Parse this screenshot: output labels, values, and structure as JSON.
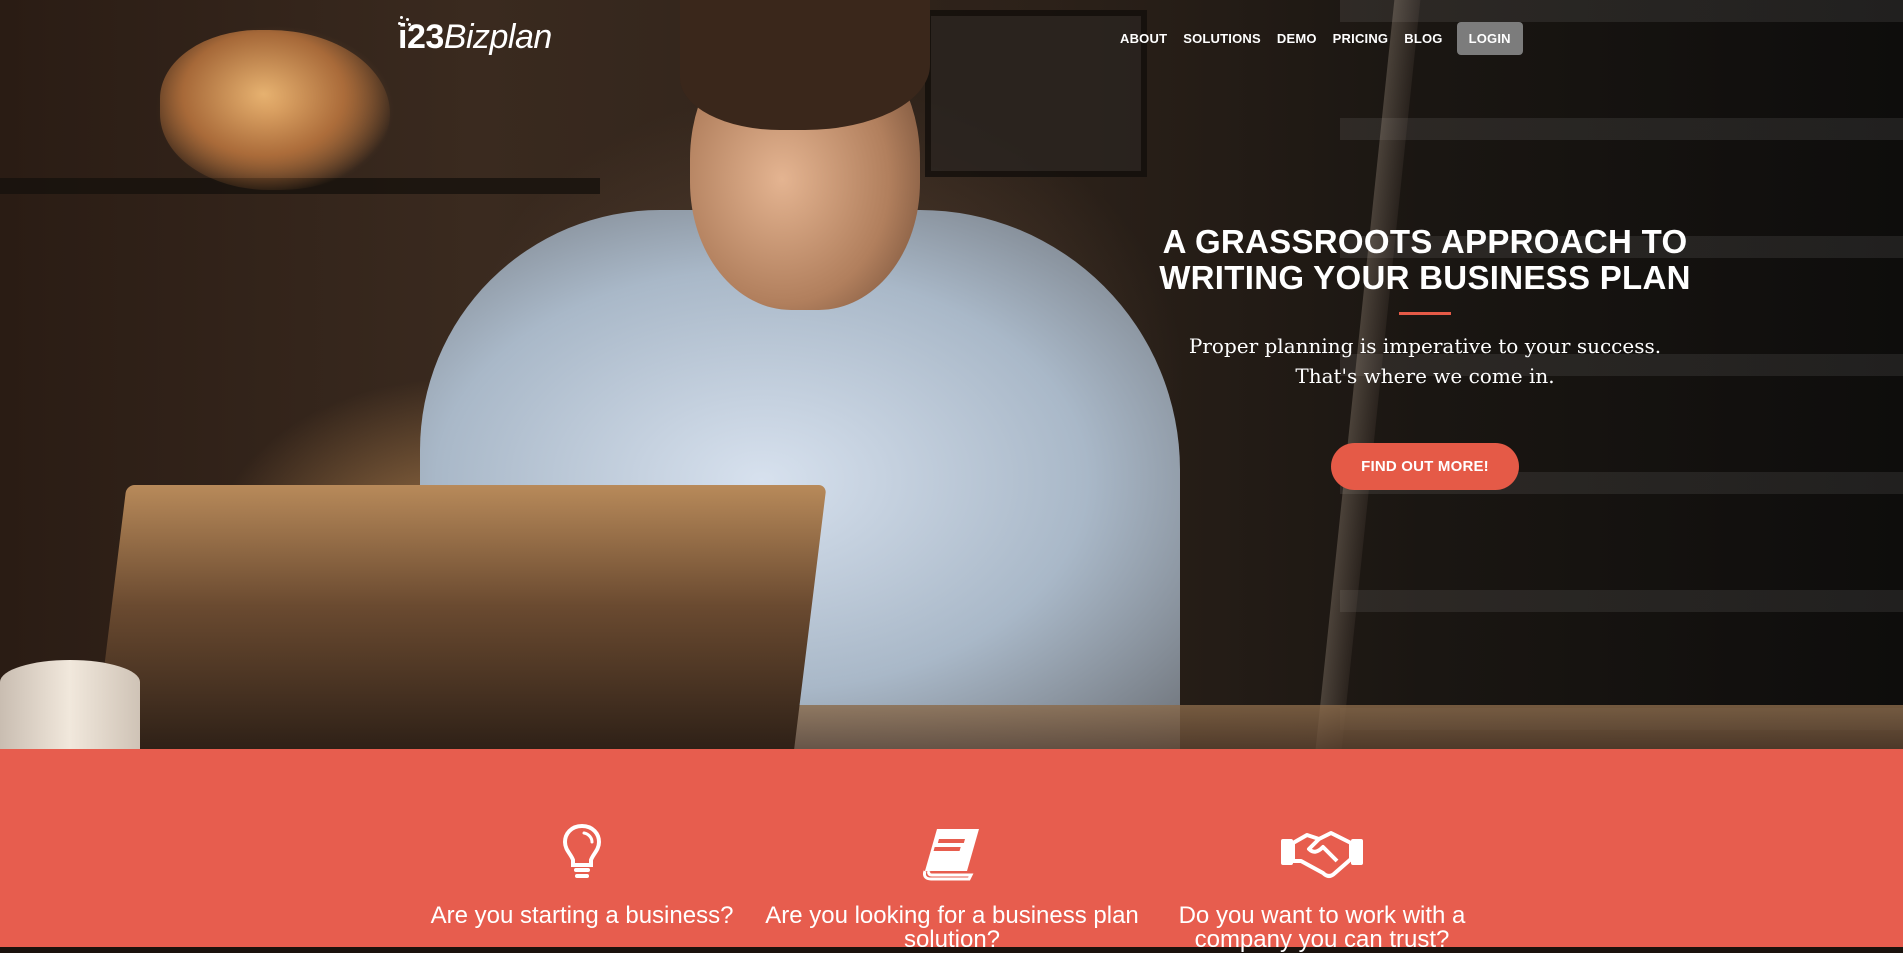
{
  "brand": {
    "logo_prefix": "i23",
    "logo_word": "Bizplan"
  },
  "nav": {
    "items": [
      "ABOUT",
      "SOLUTIONS",
      "DEMO",
      "PRICING",
      "BLOG"
    ],
    "login_label": "LOGIN"
  },
  "hero": {
    "title_line1": "A GRASSROOTS APPROACH TO",
    "title_line2": "WRITING YOUR BUSINESS PLAN",
    "subtitle_line1": "Proper planning is imperative to your success.",
    "subtitle_line2": "That's where we come in.",
    "cta_label": "FIND OUT MORE!"
  },
  "features": [
    {
      "icon": "lightbulb-icon",
      "label": "Are you starting a business?"
    },
    {
      "icon": "book-icon",
      "label": "Are you looking for a business plan solution?"
    },
    {
      "icon": "handshake-icon",
      "label": "Do you want to work with a company you can trust?"
    }
  ],
  "colors": {
    "accent": "#e75d4e",
    "cta": "#e55a47",
    "login_bg": "#7c7c7c",
    "text": "#ffffff"
  }
}
